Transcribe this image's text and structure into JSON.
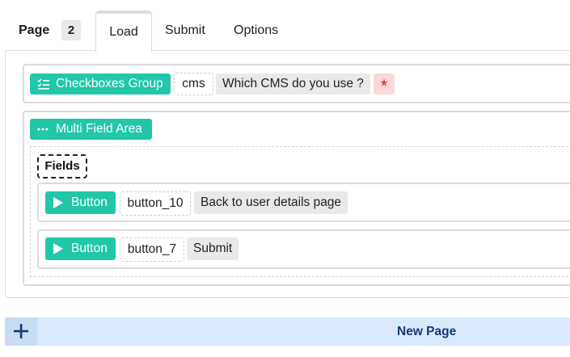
{
  "header": {
    "page_label": "Page",
    "page_number": "2",
    "tabs": [
      {
        "label": "Load",
        "active": true
      },
      {
        "label": "Submit",
        "active": false
      },
      {
        "label": "Options",
        "active": false
      }
    ]
  },
  "rows": {
    "checkbox_group": {
      "type_label": "Checkboxes Group",
      "icon": "checklist-icon",
      "name": "cms",
      "question": "Which CMS do you use ?",
      "required_mark": "*"
    },
    "multi_field": {
      "type_label": "Multi Field Area",
      "icon": "dots-icon",
      "fields_label": "Fields",
      "buttons": [
        {
          "type_label": "Button",
          "icon": "play-icon",
          "name": "button_10",
          "text": "Back to user details page"
        },
        {
          "type_label": "Button",
          "icon": "play-icon",
          "name": "button_7",
          "text": "Submit"
        }
      ]
    }
  },
  "footer": {
    "new_page_label": "New Page",
    "icon": "plus-icon"
  },
  "colors": {
    "accent": "#21c7a8",
    "required_bg": "#fbd7d7",
    "required_fg": "#c62828",
    "new_page_bg": "#dae9fb",
    "new_page_text": "#133a7a"
  }
}
